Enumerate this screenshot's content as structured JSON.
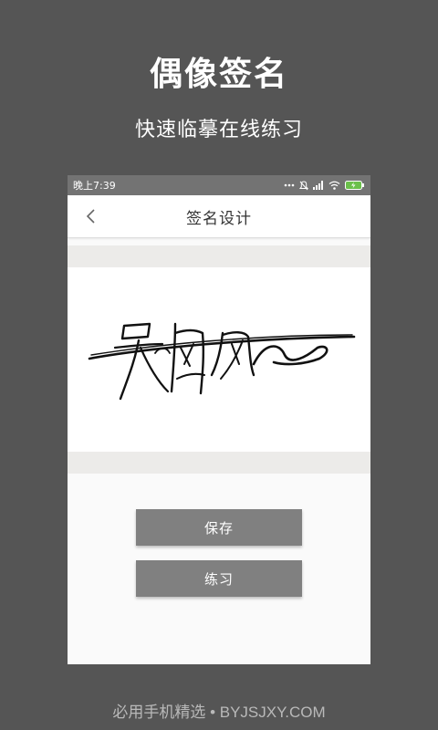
{
  "promo": {
    "title": "偶像签名",
    "subtitle": "快速临摹在线练习"
  },
  "statusbar": {
    "time": "晚上7:39",
    "icons": [
      "more-dots-icon",
      "mute-bell-icon",
      "signal-icon",
      "wifi-icon",
      "battery-icon"
    ]
  },
  "appbar": {
    "title": "签名设计",
    "back_icon": "chevron-left-icon"
  },
  "buttons": {
    "save_label": "保存",
    "practice_label": "练习"
  },
  "footer": {
    "text": "必用手机精选 • BYJSJXY.COM"
  },
  "colors": {
    "background": "#555555",
    "statusbar": "#737373",
    "button": "#808080",
    "battery": "#6bc04b"
  }
}
